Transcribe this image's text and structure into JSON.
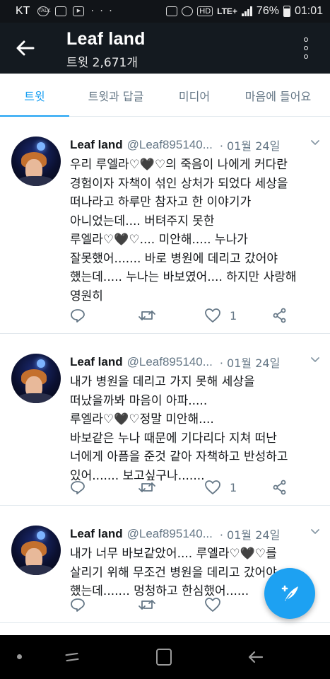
{
  "status_bar": {
    "carrier": "KT",
    "left_icons": [
      "talk-icon",
      "gallery-icon",
      "youtube-icon"
    ],
    "overflow": "· · ·",
    "hd_label": "HD",
    "network_label": "LTE+",
    "battery_percent": "76%",
    "time": "01:01"
  },
  "header": {
    "title": "Leaf land",
    "subtitle": "트윗 2,671개"
  },
  "tabs": [
    {
      "label": "트윗",
      "active": true
    },
    {
      "label": "트윗과 답글",
      "active": false
    },
    {
      "label": "미디어",
      "active": false
    },
    {
      "label": "마음에 들어요",
      "active": false
    }
  ],
  "tweets": [
    {
      "name": "Leaf land",
      "handle": "@Leaf895140...",
      "date": "· 01월 24일",
      "text": "우리 루엘라♡🖤♡의 죽음이 나에게 커다란\n경험이자 자책이 섞인 상처가 되었다 세상을\n떠나라고 하루만 참자고 한 이야기가\n아니었는데....  버텨주지 못한\n루엘라♡🖤♡.... 미안해..... 누나가\n잘못했어....... 바로 병원에 데리고 갔어야\n했는데..... 누나는 바보였어.... 하지만 사랑해\n영원히",
      "like_count": "1"
    },
    {
      "name": "Leaf land",
      "handle": "@Leaf895140...",
      "date": "· 01월 24일",
      "text": "내가 병원을 데리고 가지 못해 세상을\n떠났을까봐 마음이 아파.....\n루엘라♡🖤♡정말 미안해....\n바보같은 누나 때문에 기다리다 지쳐 떠난\n너에게 아픔을 준것 같아 자책하고 반성하고\n있어....... 보고싶구나.......",
      "like_count": "1"
    },
    {
      "name": "Leaf land",
      "handle": "@Leaf895140...",
      "date": "· 01월 24일",
      "text": "내가 너무 바보같았어.... 루엘라♡🖤♡를\n살리기 위해 무조건 병원을 데리고 갔어야\n했는데....... 멍청하고 한심했어......",
      "like_count": ""
    }
  ],
  "colors": {
    "accent": "#1da1f2",
    "header_bg": "#141a20",
    "status_bg": "#111418",
    "secondary_text": "#657786",
    "divider": "#e1e8ed"
  },
  "icons": {
    "back": "arrow-left-icon",
    "more": "more-vertical-icon",
    "reply": "reply-icon",
    "retweet": "retweet-icon",
    "like": "heart-icon",
    "share": "share-icon",
    "compose": "compose-tweet-icon"
  }
}
